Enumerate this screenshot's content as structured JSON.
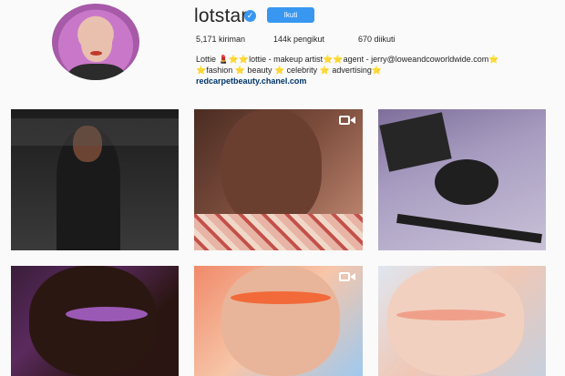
{
  "profile": {
    "username": "lotstar",
    "verified_glyph": "✓",
    "follow_label": "Ikuti",
    "stats": {
      "posts": "5,171 kiriman",
      "followers": "144k pengikut",
      "following": "670 diikuti"
    },
    "bio_line1": "Lottie 💄⭐⭐lottie - makeup artist⭐⭐agent - jerry@loweandcoworldwide.com⭐",
    "bio_line2": "⭐fashion ⭐ beauty ⭐ celebrity ⭐ advertising⭐",
    "link": "redcarpetbeauty.chanel.com"
  },
  "posts": [
    {
      "id": "post-1",
      "subject": "woman-in-black-suit",
      "video": false
    },
    {
      "id": "post-2",
      "subject": "woman-with-eyeliner",
      "video": true
    },
    {
      "id": "post-3",
      "subject": "makeup-products",
      "video": false
    },
    {
      "id": "post-4",
      "subject": "woman-purple-eyeshadow",
      "video": false
    },
    {
      "id": "post-5",
      "subject": "woman-neon-makeup",
      "video": true
    },
    {
      "id": "post-6",
      "subject": "woman-peach-eyeshadow",
      "video": false
    }
  ],
  "icons": {
    "verified": "verified-badge-icon",
    "video": "video-camera-icon"
  },
  "colors": {
    "accent": "#3897f0",
    "link": "#003569",
    "background": "#fafafa"
  }
}
